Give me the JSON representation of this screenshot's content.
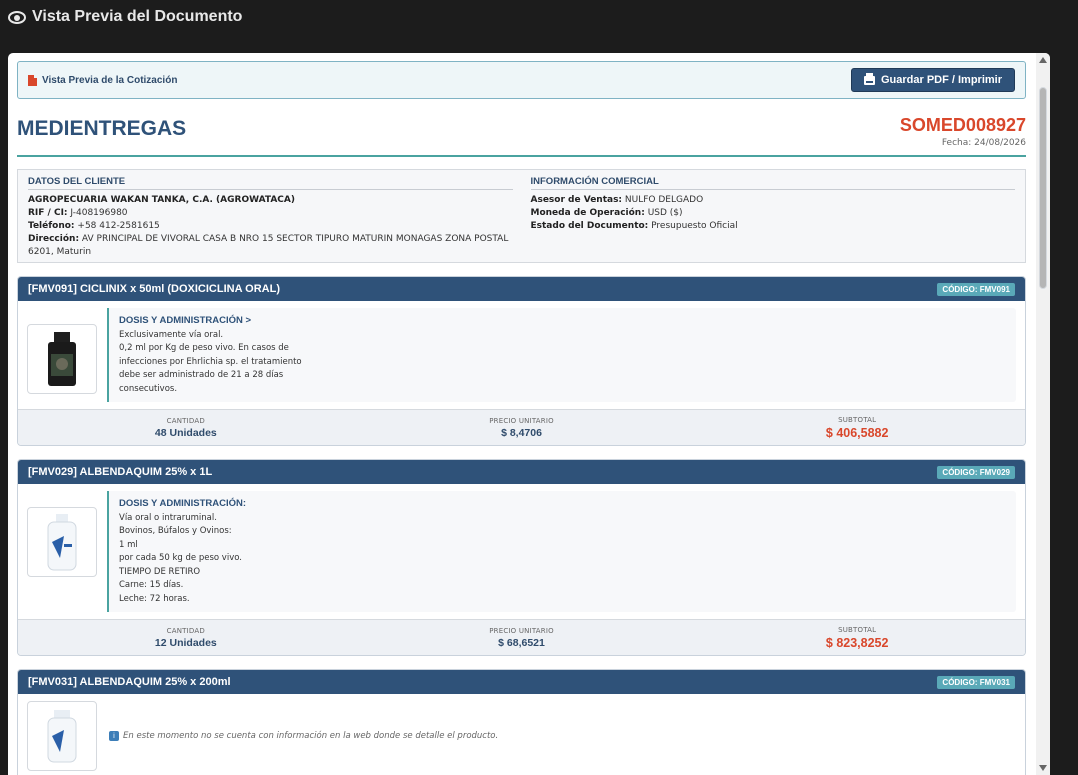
{
  "window": {
    "title": "Vista Previa del Documento"
  },
  "preview_bar": {
    "label": "Vista Previa de la Cotización",
    "print_button": "Guardar PDF / Imprimir"
  },
  "header": {
    "company": "MEDIENTREGAS",
    "quote_number": "SOMED008927",
    "date": "Fecha: 24/08/2026"
  },
  "client": {
    "heading": "DATOS DEL CLIENTE",
    "name": "AGROPECUARIA WAKAN TANKA, C.A. (AGROWATACA)",
    "rif_label": "RIF / CI:",
    "rif": "J-408196980",
    "phone_label": "Teléfono:",
    "phone": "+58 412-2581615",
    "address_label": "Dirección:",
    "address": "AV PRINCIPAL DE VIVORAL CASA B NRO 15 SECTOR TIPURO MATURIN MONAGAS ZONA POSTAL 6201, Maturin"
  },
  "commercial": {
    "heading": "INFORMACIÓN COMERCIAL",
    "advisor_label": "Asesor de Ventas:",
    "advisor": "NULFO DELGADO",
    "currency_label": "Moneda de Operación:",
    "currency": "USD ($)",
    "status_label": "Estado del Documento:",
    "status": "Presupuesto Oficial"
  },
  "labels": {
    "qty": "CANTIDAD",
    "unit_price": "PRECIO UNITARIO",
    "subtotal": "SUBTOTAL"
  },
  "products": [
    {
      "title": "[FMV091] CICLINIX x 50ml (DOXICICLINA ORAL)",
      "code": "CÓDIGO: FMV091",
      "dosage_title": "DOSIS Y ADMINISTRACIÓN >",
      "lines": [
        "Exclusivamente vía oral.",
        "0,2 ml por Kg de peso vivo. En casos de",
        "infecciones por Ehrlichia sp. el tratamiento",
        "debe ser administrado de 21 a 28 días",
        "consecutivos."
      ],
      "qty": "48 Unidades",
      "unit_price": "$ 8,4706",
      "subtotal": "$ 406,5882"
    },
    {
      "title": "[FMV029] ALBENDAQUIM 25% x 1L",
      "code": "CÓDIGO: FMV029",
      "dosage_title": "DOSIS Y ADMINISTRACIÓN:",
      "lines": [
        "Vía oral o intraruminal.",
        "Bovinos, Búfalos y Ovinos:",
        "1 ml",
        "por cada 50 kg de peso vivo.",
        "TIEMPO DE RETIRO",
        "Carne: 15 días.",
        "Leche: 72 horas."
      ],
      "qty": "12 Unidades",
      "unit_price": "$ 68,6521",
      "subtotal": "$ 823,8252"
    },
    {
      "title": "[FMV031] ALBENDAQUIM 25% x 200ml",
      "code": "CÓDIGO: FMV031",
      "no_info": "En este momento no se cuenta con información en la web donde se detalle el producto."
    }
  ]
}
